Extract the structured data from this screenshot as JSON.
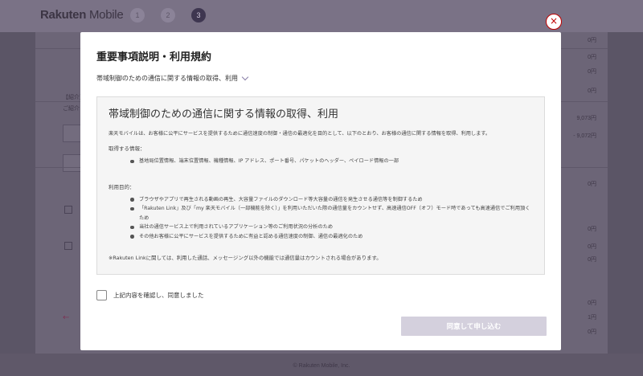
{
  "background": {
    "logo_brand": "Rakuten",
    "logo_product": "Mobile",
    "steps": [
      "1",
      "2",
      "3"
    ],
    "prices_right": [
      "0円",
      "0円",
      "0円",
      "0円",
      "9,073円",
      "- 9,072円",
      "0円",
      "0円",
      "0円",
      "0円",
      "0円",
      "1円",
      "0円"
    ],
    "left_texts": [
      "【紹介】",
      "ご紹介"
    ],
    "back_link": "←",
    "copyright": "© Rakuten Mobile, Inc."
  },
  "modal": {
    "title": "重要事項説明・利用規約",
    "accordion_label": "帯域制御のための通信に関する情報の取得、利用",
    "panel": {
      "title": "帯域制御のための通信に関する情報の取得、利用",
      "intro": "楽天モバイルは、お客様に公平にサービスを提供するために通信速度の制御・通信の最適化を目的として、以下のとおり、お客様の通信に関する情報を取得、利用します。",
      "section1_label": "取得する情報：",
      "section1_items": [
        "基地局位置情報、端末位置情報、機種情報、IP アドレス、ポート番号、パケットのヘッダー、ペイロード情報の一部"
      ],
      "section2_label": "利用目的：",
      "section2_items": [
        "ブラウザやアプリで再生される動画の再生、大容量ファイルのダウンロード等大容量の通信を発生させる通信等を制御するため",
        "「Rakuten Link」及び「my 楽天モバイル（一部機能を除く）」を利用いただいた際の通信量をカウントせず、高速通信OFF（オフ）モード時であっても高速通信でご利用頂くため",
        "当社の通信サービス上で利用されているアプリケーション等のご利用状況の分析のため",
        "その他お客様に公平にサービスを提供するために有益と認める通信速度の制御、通信の最適化のため"
      ],
      "note": "※Rakuten Linkに関しては、利用した通話、メッセージング以外の機能では通信量はカウントされる場合があります。"
    },
    "agree_label": "上記内容を確認し、同意しました",
    "submit_label": "同意して申し込む",
    "close_symbol": "×"
  },
  "colors": {
    "overlay": "#5b5566",
    "brand_red": "#bf0000",
    "button_disabled": "#d4d0dd"
  }
}
